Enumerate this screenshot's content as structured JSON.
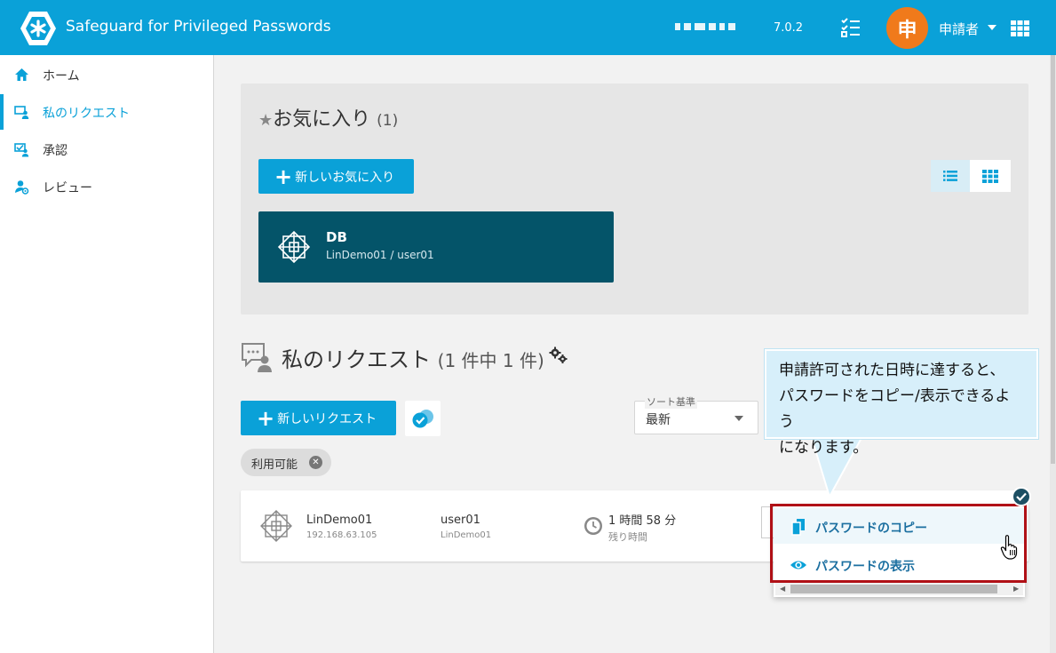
{
  "header": {
    "app_title": "Safeguard for Privileged Passwords",
    "version": "7.0.2",
    "avatar_initial": "申",
    "user_name": "申請者",
    "colors": {
      "bar": "#0aa1d8",
      "avatar": "#f07a1b"
    }
  },
  "sidebar": {
    "items": [
      {
        "label": "ホーム",
        "icon": "home-icon",
        "active": false
      },
      {
        "label": "私のリクエスト",
        "icon": "request-icon",
        "active": true
      },
      {
        "label": "承認",
        "icon": "approval-icon",
        "active": false
      },
      {
        "label": "レビュー",
        "icon": "review-icon",
        "active": false
      }
    ]
  },
  "favorites": {
    "star": "★",
    "title": "お気に入り",
    "count": "(1)",
    "new_button": "新しいお気に入り",
    "card": {
      "name": "DB",
      "sub": "LinDemo01 / user01"
    }
  },
  "requests": {
    "title": "私のリクエスト",
    "count": "(1 件中 1 件)",
    "new_button": "新しいリクエスト",
    "sort_label": "ソート基準",
    "sort_value": "最新",
    "filter_chip": "利用可能",
    "card": {
      "asset_name": "LinDemo01",
      "asset_ip": "192.168.63.105",
      "account": "user01",
      "account_asset": "LinDemo01",
      "time_left": "1 時間 58 分",
      "time_left_label": "残り時間"
    },
    "menu": [
      {
        "label": "パスワードのコピー",
        "icon": "copy-icon"
      },
      {
        "label": "パスワードの表示",
        "icon": "eye-icon"
      }
    ]
  },
  "callout": {
    "lines": [
      "申請許可された日時に達すると、",
      "パスワードをコピー/表示できるよう",
      "になります。"
    ]
  }
}
